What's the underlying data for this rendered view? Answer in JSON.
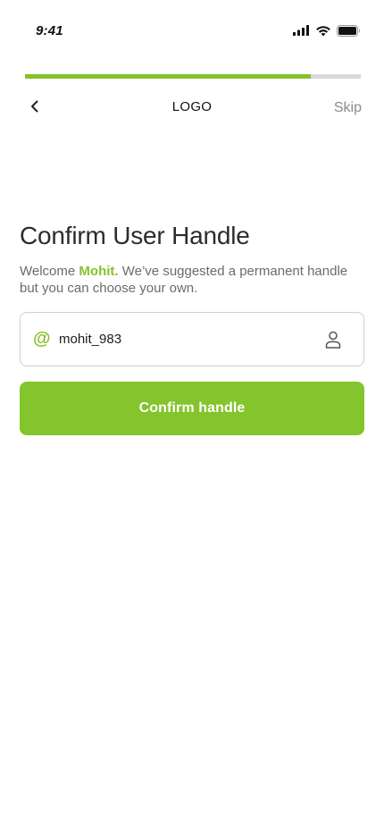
{
  "status_bar": {
    "time": "9:41",
    "icons": [
      "signal-icon",
      "wifi-icon",
      "battery-icon"
    ]
  },
  "progress": {
    "fraction": 0.85,
    "fill_color": "#84c22c",
    "track_color": "#d9d9d9"
  },
  "nav": {
    "back_icon": "chevron-left-icon",
    "logo_text": "LOGO",
    "skip_label": "Skip"
  },
  "content": {
    "title": "Confirm User Handle",
    "subtitle_prefix": "Welcome ",
    "user_name": "Mohit.",
    "subtitle_suffix": " We’ve suggested a permanent handle but you can choose your own."
  },
  "handle_field": {
    "prefix_symbol": "@",
    "value": "mohit_983",
    "trailing_icon": "user-icon"
  },
  "confirm_button": {
    "label": "Confirm handle"
  },
  "colors": {
    "accent": "#84c22c",
    "title": "#2c2c2c",
    "muted": "#6b6b6b"
  }
}
